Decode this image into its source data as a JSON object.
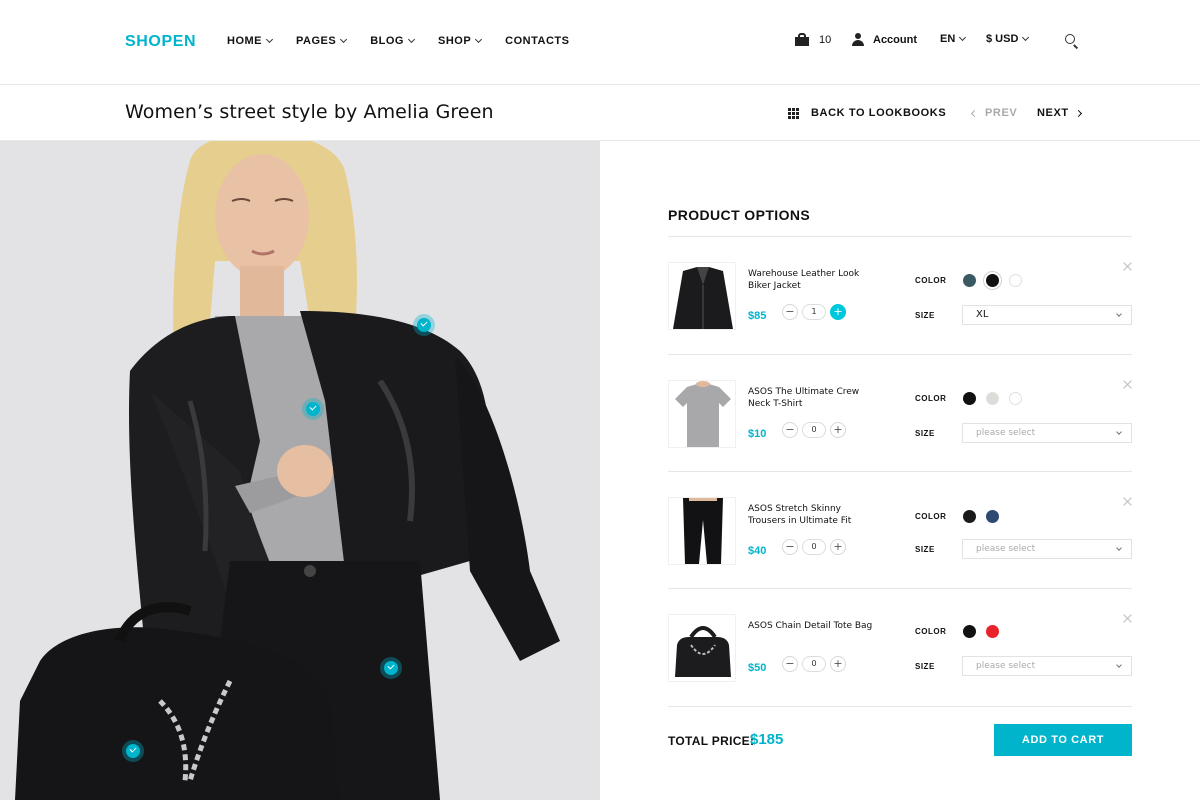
{
  "header": {
    "logo": "SHOPEN",
    "nav": [
      {
        "label": "HOME",
        "has_dropdown": true
      },
      {
        "label": "PAGES",
        "has_dropdown": true
      },
      {
        "label": "BLOG",
        "has_dropdown": true
      },
      {
        "label": "SHOP",
        "has_dropdown": true
      },
      {
        "label": "CONTACTS",
        "has_dropdown": false
      }
    ],
    "cart_count": "10",
    "account_label": "Account",
    "language": "EN",
    "currency": "$ USD",
    "icons": {
      "cart": "shopping-bag-icon",
      "account": "user-icon",
      "search": "search-icon"
    }
  },
  "subbar": {
    "title": "Women’s street style by Amelia Green",
    "back_label": "BACK TO LOOKBOOKS",
    "prev_label": "PREV",
    "next_label": "NEXT"
  },
  "hero": {
    "hotspots": [
      "jacket",
      "t-shirt",
      "trousers",
      "tote-bag"
    ]
  },
  "options": {
    "title": "PRODUCT OPTIONS",
    "color_label": "COLOR",
    "size_label": "SIZE",
    "products": [
      {
        "name": "Warehouse Leather Look Biker Jacket",
        "price": "$85",
        "quantity": "1",
        "colors": [
          "#3a5a63",
          "#111111",
          "#ffffff"
        ],
        "selected_color_index": 1,
        "size": "XL",
        "size_is_placeholder": false
      },
      {
        "name": "ASOS The Ultimate Crew Neck T-Shirt",
        "price": "$10",
        "quantity": "0",
        "colors": [
          "#111111",
          "#dcdcd8",
          "#ffffff"
        ],
        "selected_color_index": -1,
        "size": "please select",
        "size_is_placeholder": true
      },
      {
        "name": "ASOS Stretch Skinny Trousers in Ultimate Fit",
        "price": "$40",
        "quantity": "0",
        "colors": [
          "#1a1a1a",
          "#2c4a72"
        ],
        "selected_color_index": -1,
        "size": "please select",
        "size_is_placeholder": true
      },
      {
        "name": "ASOS Chain Detail Tote Bag",
        "price": "$50",
        "quantity": "0",
        "colors": [
          "#111111",
          "#e8232a"
        ],
        "selected_color_index": -1,
        "size": "please select",
        "size_is_placeholder": true
      }
    ],
    "total_label": "TOTAL PRICE:",
    "total_value": "$185",
    "add_to_cart": "ADD TO CART"
  },
  "theme": {
    "accent": "#00b4cc"
  }
}
